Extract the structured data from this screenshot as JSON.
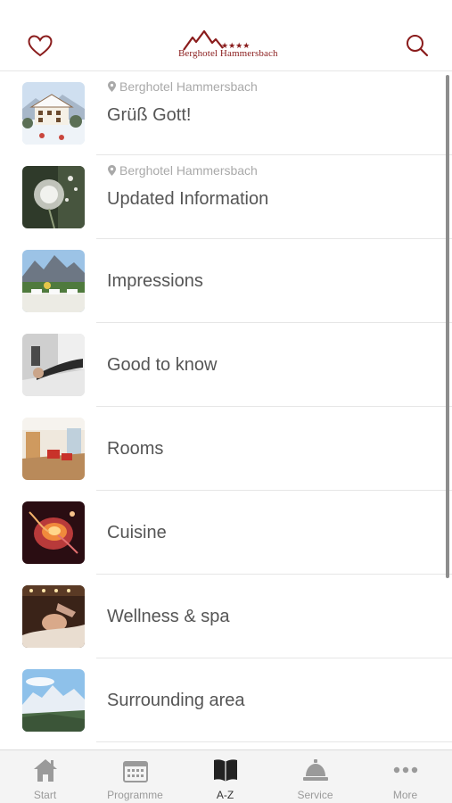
{
  "header": {
    "logo_text": "Berghotel Hammersbach",
    "favorites_icon": "heart-icon",
    "search_icon": "search-icon"
  },
  "colors": {
    "brand": "#8a1c1c",
    "text": "#555555",
    "muted": "#a9a9a9",
    "tab_active": "#333333",
    "tab_inactive": "#9a9a9a"
  },
  "list": {
    "items": [
      {
        "location": "Berghotel Hammersbach",
        "title": "Grüß Gott!",
        "thumb": "snowy-hotel"
      },
      {
        "location": "Berghotel Hammersbach",
        "title": "Updated Information",
        "thumb": "dandelion"
      },
      {
        "title": "Impressions",
        "thumb": "mountain-terrace"
      },
      {
        "title": "Good to know",
        "thumb": "relaxing-woman"
      },
      {
        "title": "Rooms",
        "thumb": "hotel-room"
      },
      {
        "title": "Cuisine",
        "thumb": "flambe"
      },
      {
        "title": "Wellness & spa",
        "thumb": "massage"
      },
      {
        "title": "Surrounding area",
        "thumb": "alpine-view"
      }
    ]
  },
  "tabs": [
    {
      "label": "Start",
      "icon": "house-icon",
      "active": false
    },
    {
      "label": "Programme",
      "icon": "calendar-icon",
      "active": false
    },
    {
      "label": "A-Z",
      "icon": "book-icon",
      "active": true
    },
    {
      "label": "Service",
      "icon": "bell-icon",
      "active": false
    },
    {
      "label": "More",
      "icon": "more-dots-icon",
      "active": false
    }
  ]
}
